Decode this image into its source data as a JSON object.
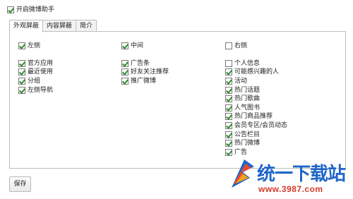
{
  "enable_helper": {
    "label": "开启微博助手",
    "checked": true
  },
  "tabs": [
    {
      "label": "外观屏蔽",
      "active": true
    },
    {
      "label": "内容屏蔽",
      "active": false
    },
    {
      "label": "简介",
      "active": false
    }
  ],
  "columns": {
    "left": {
      "header": {
        "label": "左侧",
        "checked": true
      },
      "items": [
        {
          "label": "官方应用",
          "checked": true
        },
        {
          "label": "最近使用",
          "checked": true
        },
        {
          "label": "分组",
          "checked": true
        },
        {
          "label": "左侧导航",
          "checked": true
        }
      ]
    },
    "middle": {
      "header": {
        "label": "中间",
        "checked": true
      },
      "items": [
        {
          "label": "广告条",
          "checked": true
        },
        {
          "label": "好友关注推荐",
          "checked": true
        },
        {
          "label": "推广微博",
          "checked": true
        }
      ]
    },
    "right": {
      "header": {
        "label": "右侧",
        "checked": false
      },
      "items": [
        {
          "label": "个人信息",
          "checked": false
        },
        {
          "label": "可能感兴趣的人",
          "checked": true
        },
        {
          "label": "活动",
          "checked": true
        },
        {
          "label": "热门话题",
          "checked": true
        },
        {
          "label": "热门歌曲",
          "checked": true
        },
        {
          "label": "人气图书",
          "checked": true
        },
        {
          "label": "热门商品推荐",
          "checked": true
        },
        {
          "label": "会员专区/会员动态",
          "checked": true
        },
        {
          "label": "公告栏目",
          "checked": true
        },
        {
          "label": "热门微博",
          "checked": true
        },
        {
          "label": "广告",
          "checked": true
        }
      ]
    }
  },
  "save_label": "保存",
  "watermark": {
    "brand": "统一下载站",
    "url": "www.3987.com"
  }
}
